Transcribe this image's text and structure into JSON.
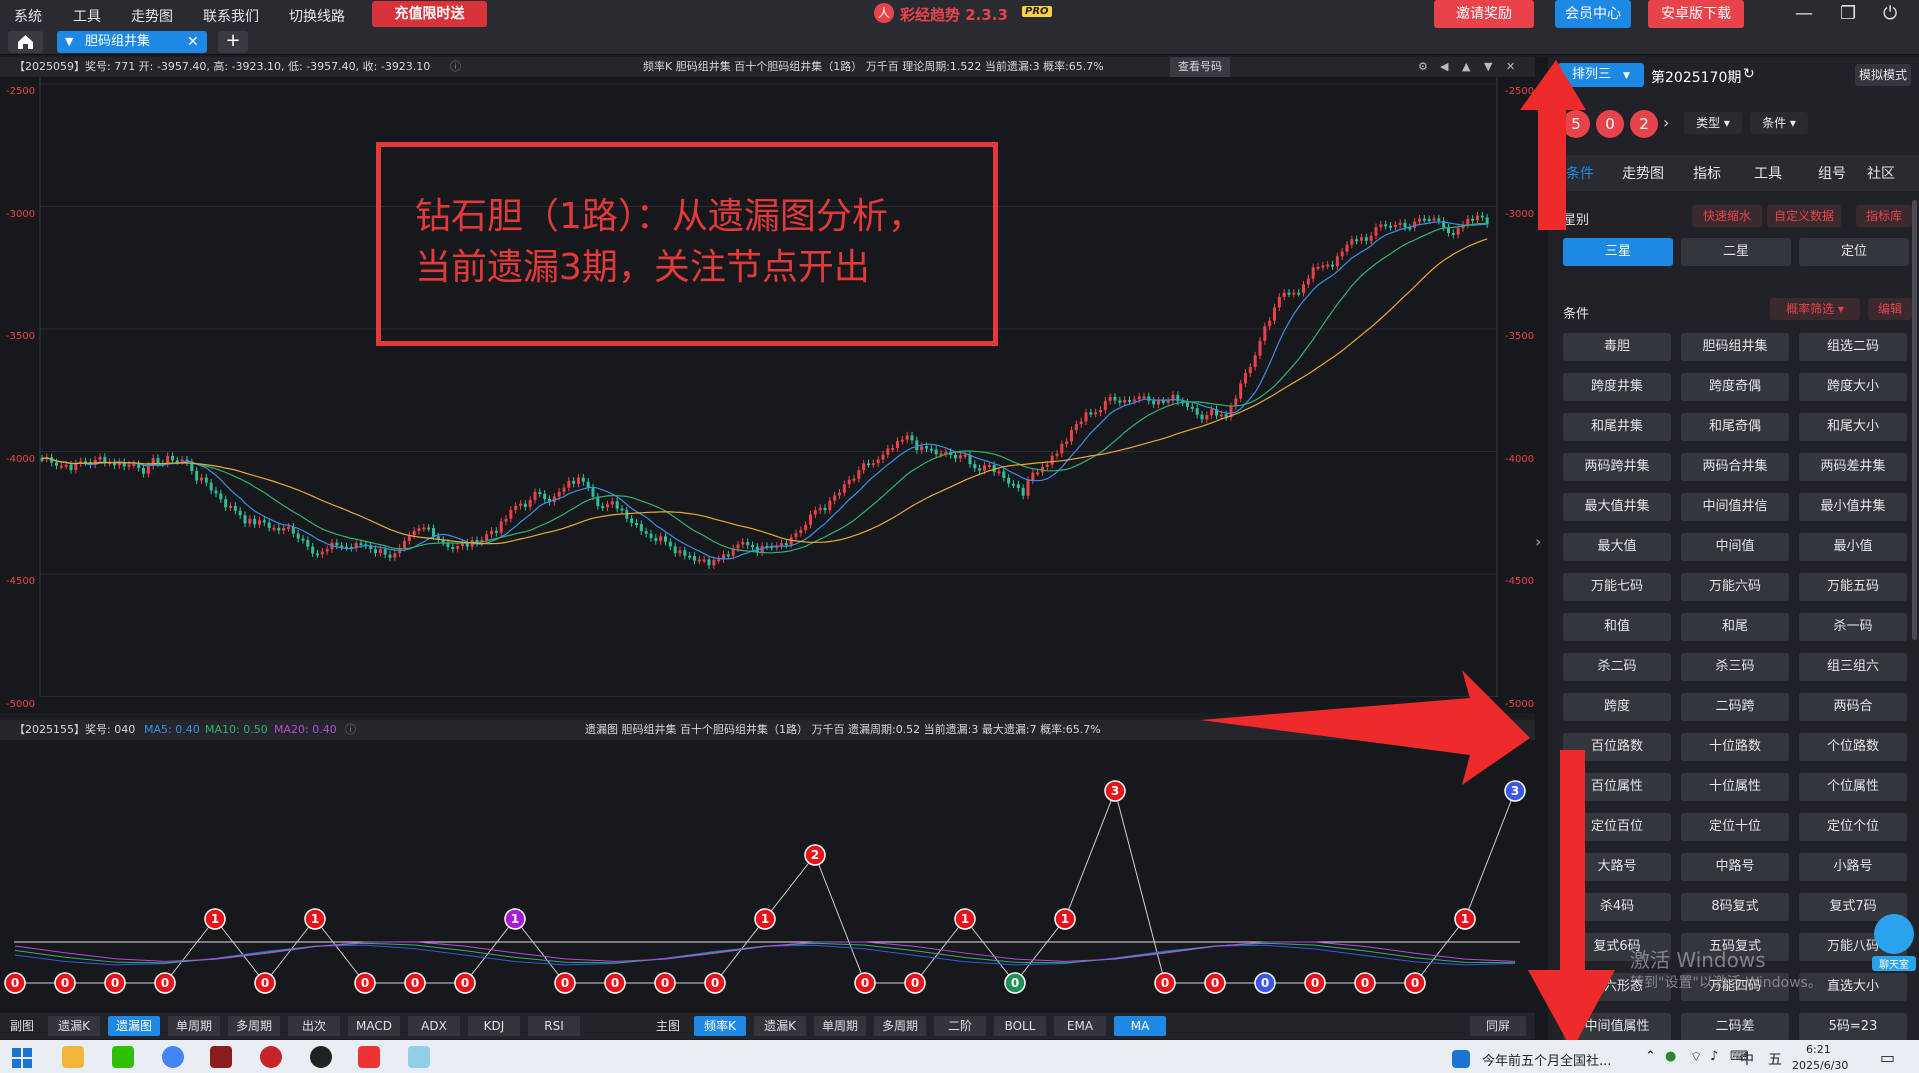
{
  "menu": [
    "系统",
    "工具",
    "走势图",
    "联系我们",
    "切换线路"
  ],
  "promo_label": "充值限时送",
  "app": {
    "title": "彩经趋势 2.3.3",
    "badge": "PRO",
    "logo_icon": "app-logo-icon"
  },
  "top_buttons": {
    "invite": "邀请奖励",
    "member": "会员中心",
    "android": "安卓版下载"
  },
  "tabs": {
    "active": "胆码组井集"
  },
  "main_info": {
    "left": "【2025059】奖号: 771  开: -3957.40, 高: -3923.10, 低: -3957.40, 收: -3923.10",
    "center": "频率K  胆码组井集  百十个胆码组井集（1路）  万千百  理论周期:1.522  当前遗漏:3  概率:65.7%",
    "view_btn": "查看号码"
  },
  "y_axis": [
    "-2500",
    "-3000",
    "-3500",
    "-4000",
    "-4500",
    "-5000"
  ],
  "annotation": {
    "line1": "钻石胆（1路）：从遗漏图分析，",
    "line2": "当前遗漏3期，关注节点开出"
  },
  "sub_info": {
    "left_prefix": "【2025155】奖号: 040 ",
    "ma5": "MA5: 0.40",
    "ma10": "MA10: 0.50",
    "ma20": "MA20: 0.40",
    "center": "遗漏图  胆码组井集  百十个胆码组井集（1路）  万千百  遗漏周期:0.52  当前遗漏:3  最大遗漏:7  概率:65.7%"
  },
  "bottom_left": [
    "副图",
    "遗漏K",
    "遗漏图",
    "单周期",
    "多周期",
    "出次",
    "MACD",
    "ADX",
    "KDJ",
    "RSI"
  ],
  "bottom_right": [
    "主图",
    "频率K",
    "遗漏K",
    "单周期",
    "多周期",
    "二阶",
    "BOLL",
    "EMA",
    "MA"
  ],
  "bottom_end": "同屏",
  "right": {
    "lottery": "排列三",
    "period": "第2025170期",
    "sim": "模拟模式",
    "balls": [
      "5",
      "0",
      "2"
    ],
    "type_label": "类型",
    "cond_label": "条件",
    "tabs": [
      "条件",
      "走势图",
      "指标",
      "工具",
      "组号",
      "社区"
    ],
    "star_label": "星别",
    "star_links": [
      "快速缩水",
      "自定义数据",
      "指标库"
    ],
    "stars": [
      "三星",
      "二星",
      "定位"
    ],
    "cond_header": "条件",
    "prob_filter": "概率筛选",
    "edit": "编辑",
    "conditions": [
      [
        "毒胆",
        "胆码组井集",
        "组选二码"
      ],
      [
        "跨度井集",
        "跨度奇偶",
        "跨度大小"
      ],
      [
        "和尾井集",
        "和尾奇偶",
        "和尾大小"
      ],
      [
        "两码跨井集",
        "两码合井集",
        "两码差井集"
      ],
      [
        "最大值井集",
        "中间值井信",
        "最小值井集"
      ],
      [
        "最大值",
        "中间值",
        "最小值"
      ],
      [
        "万能七码",
        "万能六码",
        "万能五码"
      ],
      [
        "和值",
        "和尾",
        "杀一码"
      ],
      [
        "杀二码",
        "杀三码",
        "组三组六"
      ],
      [
        "跨度",
        "二码跨",
        "两码合"
      ],
      [
        "百位路数",
        "十位路数",
        "个位路数"
      ],
      [
        "百位属性",
        "十位属性",
        "个位属性"
      ],
      [
        "定位百位",
        "定位十位",
        "定位个位"
      ],
      [
        "大路号",
        "中路号",
        "小路号"
      ],
      [
        "杀4码",
        "8码复式",
        "复式7码"
      ],
      [
        "复式6码",
        "五码复式",
        "万能八码"
      ],
      [
        "组六形态",
        "万能四码",
        "直选大小"
      ],
      [
        "中间值属性",
        "二码差",
        "5码=23"
      ]
    ],
    "chat": "聊天室",
    "activate_line1": "激活 Windows",
    "activate_line2": "转到\"设置\"以激活 Windows。"
  },
  "taskbar": {
    "news": "今年前五个月全国社...",
    "time": "6:21",
    "date": "2025/6/30",
    "ime": "中",
    "layout": "五"
  },
  "miss_markers": [
    {
      "v": "0",
      "c": "#e8121a"
    },
    {
      "v": "0",
      "c": "#e8121a"
    },
    {
      "v": "0",
      "c": "#e8121a"
    },
    {
      "v": "0",
      "c": "#e8121a"
    },
    {
      "v": "1",
      "c": "#e8121a"
    },
    {
      "v": "0",
      "c": "#e8121a"
    },
    {
      "v": "1",
      "c": "#e8121a"
    },
    {
      "v": "0",
      "c": "#e8121a"
    },
    {
      "v": "0",
      "c": "#e8121a"
    },
    {
      "v": "0",
      "c": "#e8121a"
    },
    {
      "v": "1",
      "c": "#a81ad8"
    },
    {
      "v": "0",
      "c": "#e8121a"
    },
    {
      "v": "0",
      "c": "#e8121a"
    },
    {
      "v": "0",
      "c": "#e8121a"
    },
    {
      "v": "0",
      "c": "#e8121a"
    },
    {
      "v": "1",
      "c": "#e8121a"
    },
    {
      "v": "2",
      "c": "#e8121a"
    },
    {
      "v": "0",
      "c": "#e8121a"
    },
    {
      "v": "0",
      "c": "#e8121a"
    },
    {
      "v": "1",
      "c": "#e8121a"
    },
    {
      "v": "0",
      "c": "#1f8f5a"
    },
    {
      "v": "1",
      "c": "#e8121a"
    },
    {
      "v": "3",
      "c": "#e8121a"
    },
    {
      "v": "0",
      "c": "#e8121a"
    },
    {
      "v": "0",
      "c": "#e8121a"
    },
    {
      "v": "0",
      "c": "#3a57e8"
    },
    {
      "v": "0",
      "c": "#e8121a"
    },
    {
      "v": "0",
      "c": "#e8121a"
    },
    {
      "v": "0",
      "c": "#e8121a"
    },
    {
      "v": "1",
      "c": "#e8121a"
    },
    {
      "v": "3",
      "c": "#3a57e8"
    }
  ]
}
